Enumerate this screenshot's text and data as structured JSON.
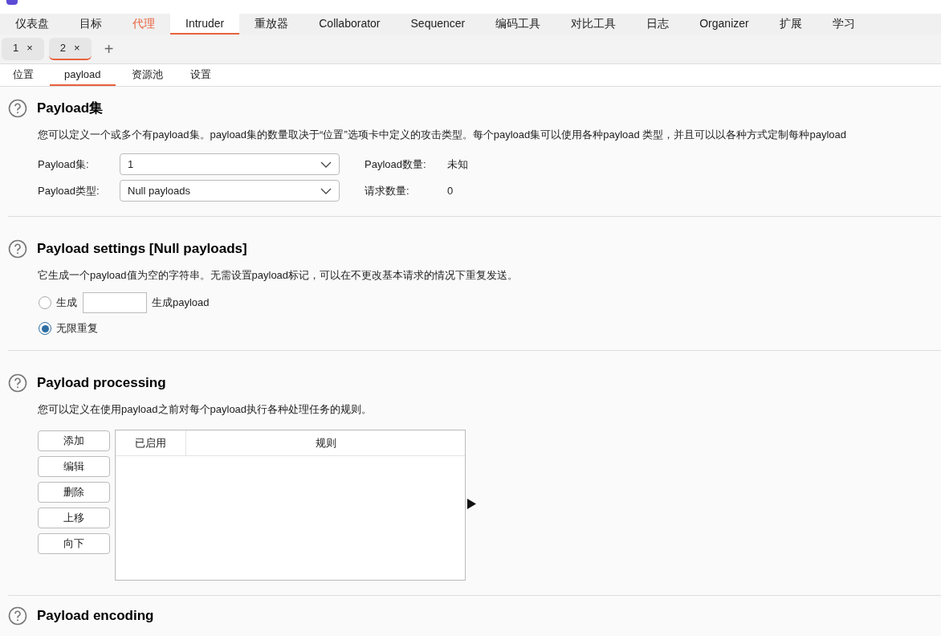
{
  "main_tabs": [
    {
      "label": "仪表盘",
      "selected": false,
      "accent": false
    },
    {
      "label": "目标",
      "selected": false,
      "accent": false
    },
    {
      "label": "代理",
      "selected": false,
      "accent": true
    },
    {
      "label": "Intruder",
      "selected": true,
      "accent": false
    },
    {
      "label": "重放器",
      "selected": false,
      "accent": false
    },
    {
      "label": "Collaborator",
      "selected": false,
      "accent": false
    },
    {
      "label": "Sequencer",
      "selected": false,
      "accent": false
    },
    {
      "label": "编码工具",
      "selected": false,
      "accent": false
    },
    {
      "label": "对比工具",
      "selected": false,
      "accent": false
    },
    {
      "label": "日志",
      "selected": false,
      "accent": false
    },
    {
      "label": "Organizer",
      "selected": false,
      "accent": false
    },
    {
      "label": "扩展",
      "selected": false,
      "accent": false
    },
    {
      "label": "学习",
      "selected": false,
      "accent": false
    }
  ],
  "attack_tabs": [
    {
      "label": "1",
      "close": "×",
      "selected": false
    },
    {
      "label": "2",
      "close": "×",
      "selected": true
    }
  ],
  "add_tab": "+",
  "sub_tabs": [
    {
      "label": "位置",
      "selected": false
    },
    {
      "label": "payload",
      "selected": true
    },
    {
      "label": "资源池",
      "selected": false
    },
    {
      "label": "设置",
      "selected": false
    }
  ],
  "payload_sets": {
    "title": "Payload集",
    "description": "您可以定义一个或多个有payload集。payload集的数量取决于“位置”选项卡中定义的攻击类型。每个payload集可以使用各种payload 类型，并且可以以各种方式定制每种payload",
    "fields": [
      {
        "label": "Payload集:",
        "value": "1",
        "info_label": "Payload数量:",
        "info_value": "未知"
      },
      {
        "label": "Payload类型:",
        "value": "Null payloads",
        "info_label": "请求数量:",
        "info_value": "0"
      }
    ]
  },
  "payload_settings": {
    "title": "Payload settings [Null payloads]",
    "description": "它生成一个payload值为空的字符串。无需设置payload标记，可以在不更改基本请求的情况下重复发送。",
    "options": [
      {
        "kind": "count",
        "label": "生成",
        "suffix": "生成payload",
        "selected": false
      },
      {
        "kind": "plain",
        "label": "无限重复",
        "selected": true
      }
    ]
  },
  "payload_processing": {
    "title": "Payload processing",
    "description": "您可以定义在使用payload之前对每个payload执行各种处理任务的规则。",
    "buttons": [
      "添加",
      "编辑",
      "删除",
      "上移",
      "向下"
    ],
    "columns": [
      "已启用",
      "规则"
    ]
  },
  "payload_encoding": {
    "title": "Payload encoding"
  }
}
